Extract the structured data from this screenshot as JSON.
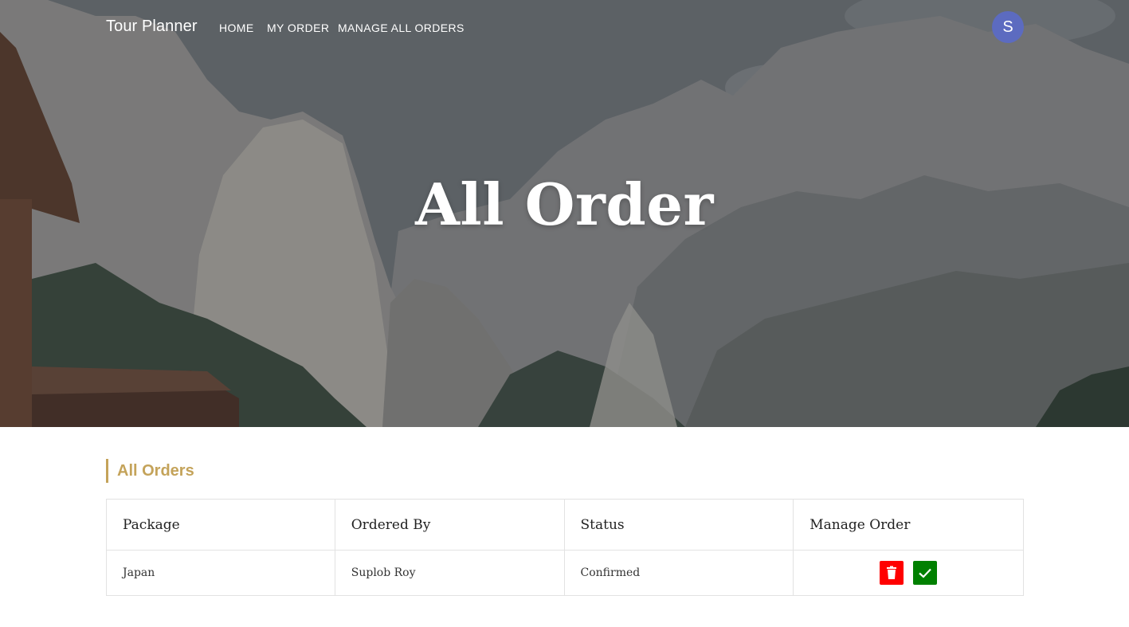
{
  "nav": {
    "brand": "Tour Planner",
    "links": [
      "HOME",
      "MY ORDER",
      "MANAGE ALL ORDERS"
    ],
    "avatar_initial": "S"
  },
  "hero": {
    "title": "All Order"
  },
  "section": {
    "title": "All Orders"
  },
  "table": {
    "headers": [
      "Package",
      "Ordered By",
      "Status",
      "Manage Order"
    ],
    "rows": [
      {
        "package": "Japan",
        "ordered_by": "Suplob Roy",
        "status": "Confirmed"
      }
    ]
  },
  "colors": {
    "accent": "#c4a35a",
    "avatar": "#5c6bc0",
    "delete": "#ff0000",
    "confirm": "#008000"
  },
  "icons": {
    "delete": "trash-icon",
    "confirm": "check-icon"
  }
}
